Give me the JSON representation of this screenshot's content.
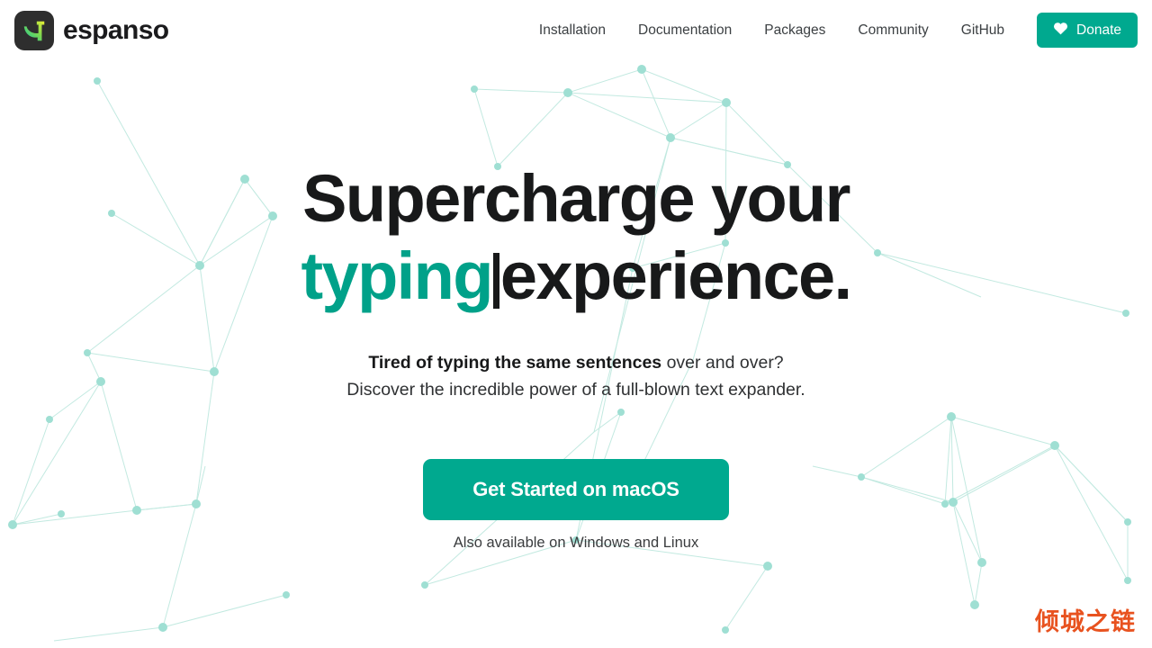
{
  "brand": {
    "name": "espanso",
    "logo_icon": "espanso-bird-logo",
    "logo_bg": "#2e2e2e",
    "logo_gradient_from": "#19c39c",
    "logo_gradient_to": "#e4ec3a"
  },
  "nav": {
    "items": [
      {
        "label": "Installation"
      },
      {
        "label": "Documentation"
      },
      {
        "label": "Packages"
      },
      {
        "label": "Community"
      },
      {
        "label": "GitHub"
      }
    ],
    "donate": {
      "label": "Donate",
      "icon": "heart-icon",
      "color": "#00a98f"
    }
  },
  "hero": {
    "headline_line1": "Supercharge your",
    "headline_accent": "typing",
    "headline_rest": "experience.",
    "accent_color": "#00a189",
    "caret": "|",
    "subtitle_strong": "Tired of typing the same sentences",
    "subtitle_rest": " over and over?",
    "subtitle_line2": "Discover the incredible power of a full-blown text expander.",
    "cta_label": "Get Started on macOS",
    "cta_color": "#00a98f",
    "cta_note": "Also available on Windows and Linux"
  },
  "watermark": {
    "text": "倾城之链",
    "color": "#e8521f"
  },
  "background": {
    "style": "constellation-network",
    "node_color": "#9fdfd3",
    "line_color": "#bfe8df"
  }
}
